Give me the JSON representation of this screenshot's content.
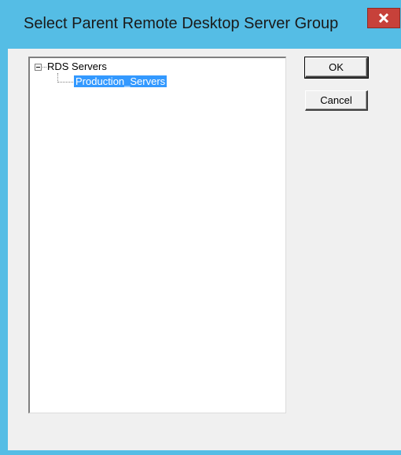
{
  "window": {
    "title": "Select Parent Remote Desktop Server Group",
    "close_glyph": "x",
    "accent_color": "#55bde5"
  },
  "tree": {
    "root_label": "RDS Servers",
    "root_expander": "minus",
    "children": [
      {
        "label": "Production_Servers",
        "selected": true
      }
    ]
  },
  "buttons": {
    "ok_label": "OK",
    "cancel_label": "Cancel"
  }
}
